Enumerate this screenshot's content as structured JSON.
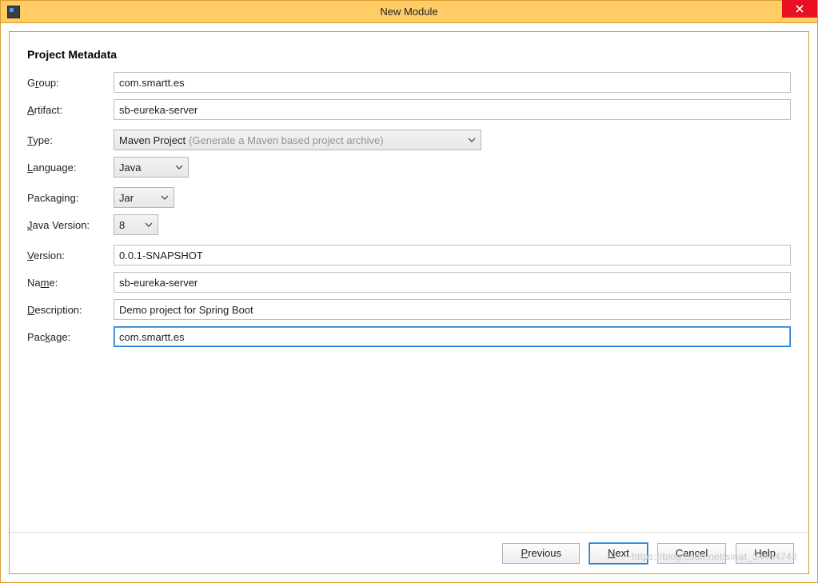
{
  "window": {
    "title": "New Module"
  },
  "section_title": "Project Metadata",
  "fields": {
    "group": {
      "label_pre": "G",
      "label_ul": "r",
      "label_post": "oup:",
      "value": "com.smartt.es"
    },
    "artifact": {
      "label_pre": "",
      "label_ul": "A",
      "label_post": "rtifact:",
      "value": "sb-eureka-server"
    },
    "type": {
      "label_pre": "",
      "label_ul": "T",
      "label_post": "ype:",
      "value": "Maven Project",
      "hint": "(Generate a Maven based project archive)"
    },
    "language": {
      "label_pre": "",
      "label_ul": "L",
      "label_post": "anguage:",
      "value": "Java"
    },
    "packaging": {
      "label_pre": "Packaging:",
      "label_ul": "",
      "label_post": "",
      "value": "Jar"
    },
    "javaversion": {
      "label_pre": "",
      "label_ul": "J",
      "label_post": "ava Version:",
      "value": "8"
    },
    "version": {
      "label_pre": "",
      "label_ul": "V",
      "label_post": "ersion:",
      "value": "0.0.1-SNAPSHOT"
    },
    "name": {
      "label_pre": "Na",
      "label_ul": "m",
      "label_post": "e:",
      "value": "sb-eureka-server"
    },
    "description": {
      "label_pre": "",
      "label_ul": "D",
      "label_post": "escription:",
      "value": "Demo project for Spring Boot"
    },
    "package": {
      "label_pre": "Pac",
      "label_ul": "k",
      "label_post": "age:",
      "value": "com.smartt.es"
    }
  },
  "buttons": {
    "previous": {
      "pre": "",
      "ul": "P",
      "post": "revious"
    },
    "next": {
      "pre": "",
      "ul": "N",
      "post": "ext"
    },
    "cancel": {
      "pre": "Cancel",
      "ul": "",
      "post": ""
    },
    "help": {
      "pre": "Help",
      "ul": "",
      "post": ""
    }
  },
  "watermark": "https://blog.csdn.net/sinat_34454743"
}
